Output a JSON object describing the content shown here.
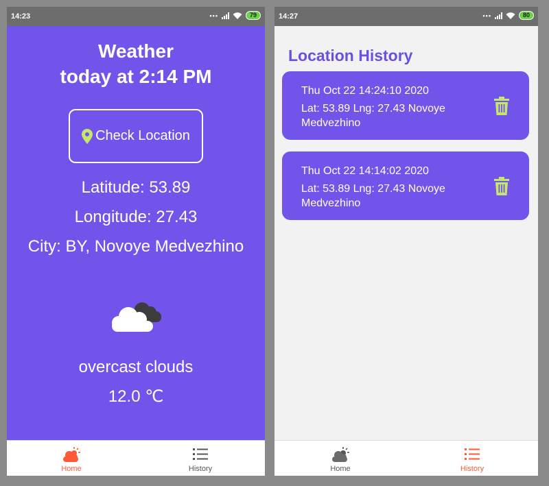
{
  "left": {
    "status": {
      "time": "14:23",
      "battery": "79"
    },
    "title_line1": "Weather",
    "title_line2": "today at 2:14 PM",
    "check_button": "Check Location",
    "latitude": "Latitude: 53.89",
    "longitude": "Longitude: 27.43",
    "city": "City: BY, Novoye Medvezhino",
    "weather_icon": "overcast-clouds-icon",
    "description": "overcast clouds",
    "temperature": "12.0 ℃",
    "nav": [
      {
        "label": "Home",
        "icon": "weather-icon",
        "active": true
      },
      {
        "label": "History",
        "icon": "list-icon",
        "active": false
      }
    ]
  },
  "right": {
    "status": {
      "time": "14:27",
      "battery": "80"
    },
    "title": "Location History",
    "entries": [
      {
        "date": "Thu Oct 22 14:24:10 2020",
        "location": "Lat: 53.89 Lng: 27.43 Novoye Medvezhino",
        "icon": "trash-icon"
      },
      {
        "date": "Thu Oct 22 14:14:02 2020",
        "location": "Lat: 53.89 Lng: 27.43 Novoye Medvezhino",
        "icon": "trash-icon"
      }
    ],
    "nav": [
      {
        "label": "Home",
        "icon": "weather-icon",
        "active": false
      },
      {
        "label": "History",
        "icon": "list-icon",
        "active": true
      }
    ]
  },
  "colors": {
    "primary": "#7254ea",
    "accent": "#ff5a36",
    "icon_green": "#c6e86a",
    "title_purple": "#6c4ee0"
  }
}
